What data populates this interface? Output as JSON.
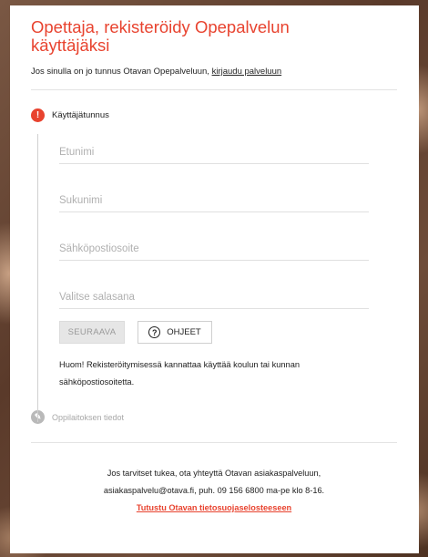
{
  "header": {
    "title": "Opettaja, rekisteröidy Opepalvelun käyttäjäksi"
  },
  "login": {
    "text": "Jos sinulla on jo tunnus Otavan Opepalveluun, ",
    "link": "kirjaudu palveluun"
  },
  "steps": {
    "step1": {
      "icon": "!",
      "label": "Käyttäjätunnus"
    },
    "step2": {
      "icon": "✎",
      "label": "Oppilaitoksen tiedot"
    }
  },
  "form": {
    "first_name_placeholder": "Etunimi",
    "last_name_placeholder": "Sukunimi",
    "email_placeholder": "Sähköpostiosoite",
    "password_placeholder": "Valitse salasana",
    "next_label": "SEURAAVA",
    "help_label": "OHJEET",
    "help_icon": "?"
  },
  "note": "Huom! Rekisteröitymisessä kannattaa käyttää koulun tai kunnan sähköpostiosoitetta.",
  "footer": {
    "line1": "Jos tarvitset tukea, ota yhteyttä Otavan asiakaspalveluun,",
    "line2": "asiakaspalvelu@otava.fi, puh. 09 156 6800 ma-pe klo 8-16.",
    "privacy_link": "Tutustu Otavan tietosuojaselosteeseen"
  },
  "colors": {
    "accent": "#e8432f",
    "inactive": "#b9b9b9"
  }
}
